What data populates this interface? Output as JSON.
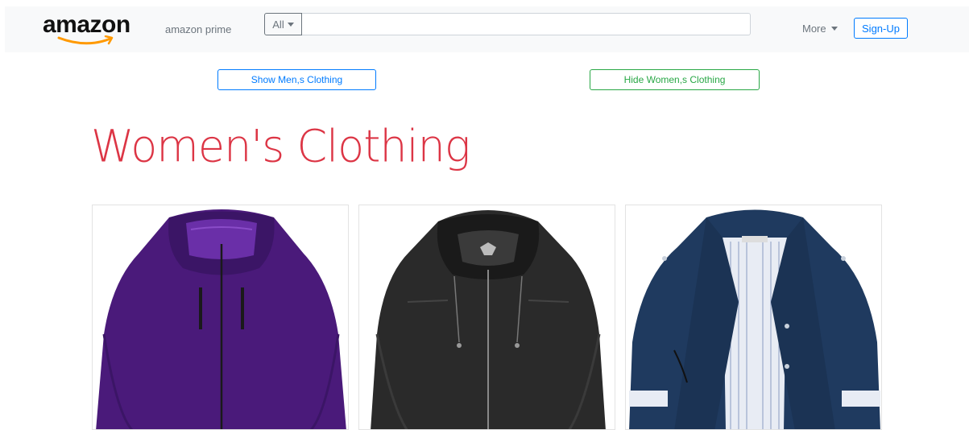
{
  "navbar": {
    "brand": "amazon",
    "prime_label": "amazon prime",
    "dept_label": "All",
    "search_placeholder": "",
    "more_label": "More",
    "signup_label": "Sign-Up"
  },
  "filters": {
    "show_men_label": "Show Men,s Clothing",
    "hide_women_label": "Hide Women,s Clothing"
  },
  "section": {
    "title": "Women's Clothing"
  },
  "products": [
    {
      "name": "purple-jacket",
      "color": "#4a1a7a"
    },
    {
      "name": "black-leather-jacket",
      "color": "#2a2a2a"
    },
    {
      "name": "navy-jacket",
      "color": "#1f3a5f"
    }
  ],
  "colors": {
    "brand_orange": "#ff9900",
    "primary": "#007bff",
    "success": "#28a745",
    "danger": "#dc3545"
  }
}
